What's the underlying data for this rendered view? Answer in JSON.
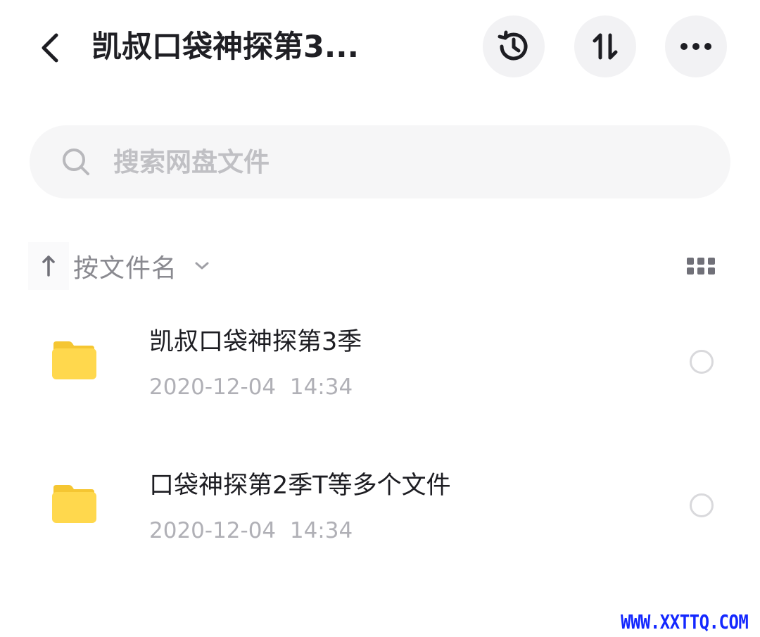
{
  "header": {
    "title": "凯叔口袋神探第3...",
    "back_icon": "chevron-left-icon",
    "actions": [
      {
        "name": "history",
        "icon": "history-icon"
      },
      {
        "name": "sort",
        "icon": "sort-arrows-icon"
      },
      {
        "name": "more",
        "icon": "more-horizontal-icon"
      }
    ]
  },
  "search": {
    "placeholder": "搜索网盘文件",
    "value": "",
    "icon": "search-icon"
  },
  "sort_bar": {
    "direction_icon": "arrow-up-icon",
    "label": "按文件名",
    "dropdown_icon": "chevron-down-icon",
    "view_toggle_icon": "grid-view-icon"
  },
  "files": [
    {
      "name": "凯叔口袋神探第3季",
      "meta": "2020-12-04  14:34",
      "type_icon": "folder-icon",
      "selected": false
    },
    {
      "name": "口袋神探第2季T等多个文件",
      "meta": "2020-12-04  14:34",
      "type_icon": "folder-icon",
      "selected": false
    }
  ],
  "colors": {
    "folder": "#ffd84d",
    "folder_tab": "#f5c632",
    "button_bg": "#f2f2f4",
    "search_bg": "#f6f6f7",
    "muted_text": "#b0b0b6",
    "watermark": "#1428ff"
  },
  "watermark": {
    "text": "WWW.XXTTQ.COM"
  }
}
